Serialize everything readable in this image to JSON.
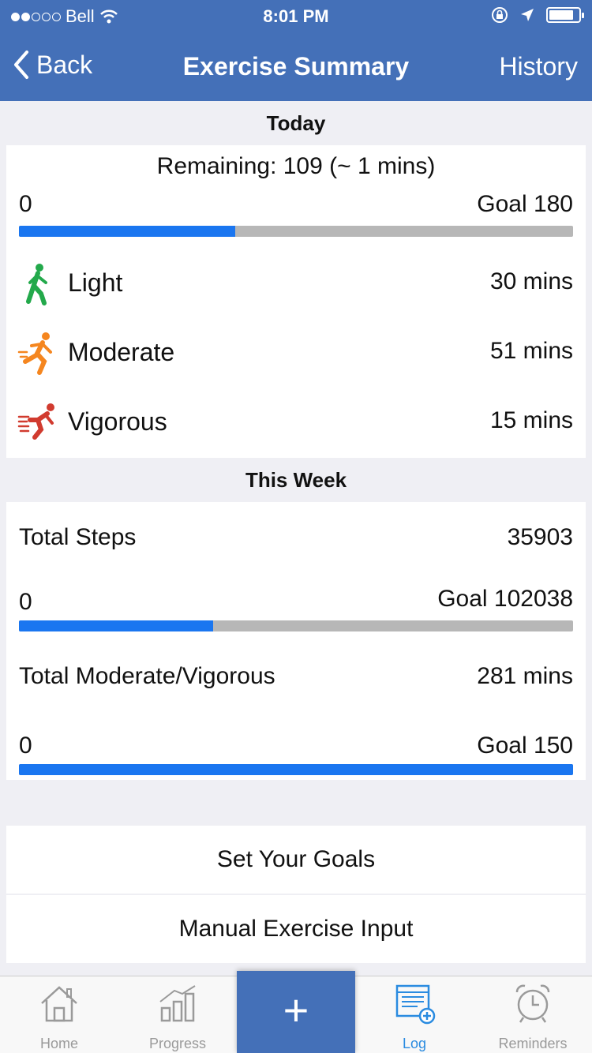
{
  "status_bar": {
    "carrier": "Bell",
    "time": "8:01 PM"
  },
  "nav": {
    "back_label": "Back",
    "title": "Exercise Summary",
    "history_label": "History"
  },
  "today": {
    "header": "Today",
    "remaining_text": "Remaining: 109 (~ 1 mins)",
    "progress_min": "0",
    "goal_text": "Goal 180",
    "progress_fraction": 0.39,
    "activities": [
      {
        "label": "Light",
        "value": "30 mins",
        "icon": "walking-icon",
        "color": "#23a94b"
      },
      {
        "label": "Moderate",
        "value": "51 mins",
        "icon": "running-icon",
        "color": "#f5861f"
      },
      {
        "label": "Vigorous",
        "value": "15 mins",
        "icon": "sprinting-icon",
        "color": "#d13b2f"
      }
    ]
  },
  "week": {
    "header": "This Week",
    "steps_label": "Total Steps",
    "steps_value": "35903",
    "steps_min": "0",
    "steps_goal": "Goal 102038",
    "steps_fraction": 0.35,
    "modvig_label": "Total Moderate/Vigorous",
    "modvig_value": "281 mins",
    "modvig_min": "0",
    "modvig_goal": "Goal 150",
    "modvig_fraction": 1.0
  },
  "buttons": {
    "set_goals": "Set Your Goals",
    "manual_input": "Manual Exercise Input"
  },
  "tabbar": {
    "home": "Home",
    "progress": "Progress",
    "add": "+",
    "log": "Log",
    "reminders": "Reminders"
  },
  "colors": {
    "nav_blue": "#4470b8",
    "progress_blue": "#1a76f0",
    "track_gray": "#b7b7b7",
    "active_tab": "#2a8be0"
  }
}
